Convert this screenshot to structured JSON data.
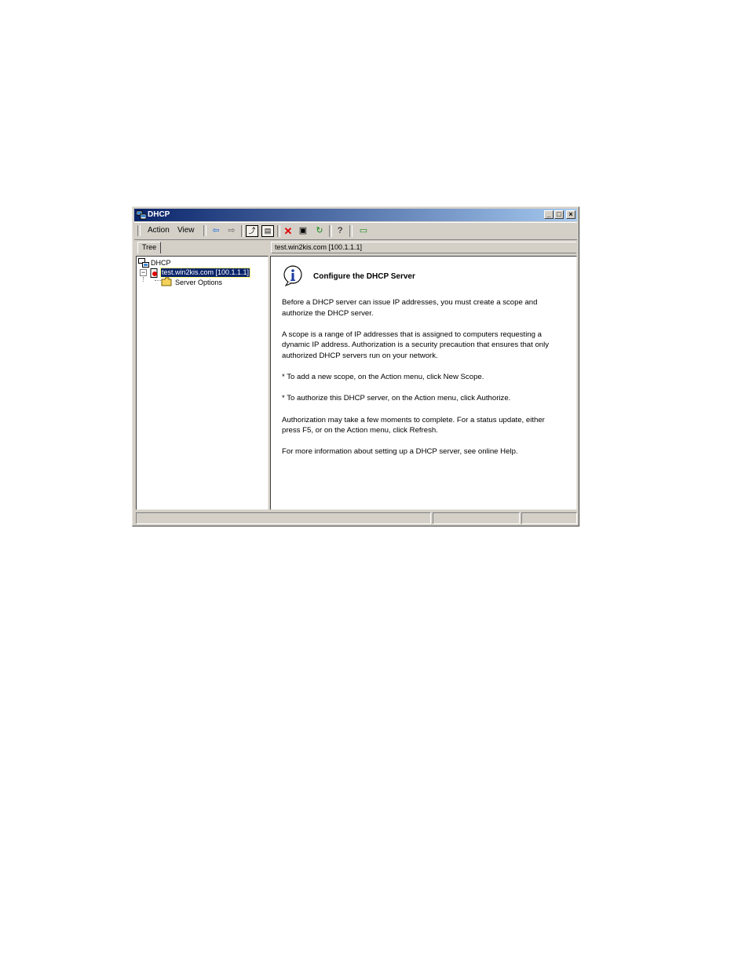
{
  "window": {
    "title": "DHCP",
    "minimize_icon": "minimize-icon",
    "maximize_icon": "maximize-icon",
    "close_icon": "close-icon"
  },
  "menu": {
    "action": "Action",
    "view": "View"
  },
  "toolbar": {
    "icons": [
      "back-arrow-icon",
      "forward-arrow-icon",
      "up-folder-icon",
      "show-hide-tree-icon",
      "delete-icon",
      "properties-icon",
      "refresh-icon",
      "help-icon",
      "monitor-icon"
    ]
  },
  "tree": {
    "tab_label": "Tree",
    "root": "DHCP",
    "server": "test.win2kis.com [100.1.1.1]",
    "server_options": "Server Options",
    "expand_glyph": "−"
  },
  "right": {
    "header": "test.win2kis.com [100.1.1.1]",
    "heading": "Configure the DHCP Server",
    "paragraphs": [
      "Before a DHCP server can issue IP addresses, you must create a scope and authorize the DHCP server.",
      "A scope is a range of IP addresses that is assigned to computers requesting a dynamic IP address. Authorization is a security precaution that ensures that only authorized DHCP servers run on your network.",
      "* To add a new scope, on the Action menu, click New Scope.",
      "* To authorize this DHCP server, on the Action menu, click Authorize.",
      "Authorization may take a few moments to complete. For a status update, either press F5, or on the Action menu, click Refresh.",
      "For more information about setting up a DHCP server, see online Help."
    ]
  },
  "colors": {
    "title_start": "#0a246a",
    "title_end": "#a6caf0",
    "selection": "#0a246a",
    "face": "#d4d0c8"
  }
}
